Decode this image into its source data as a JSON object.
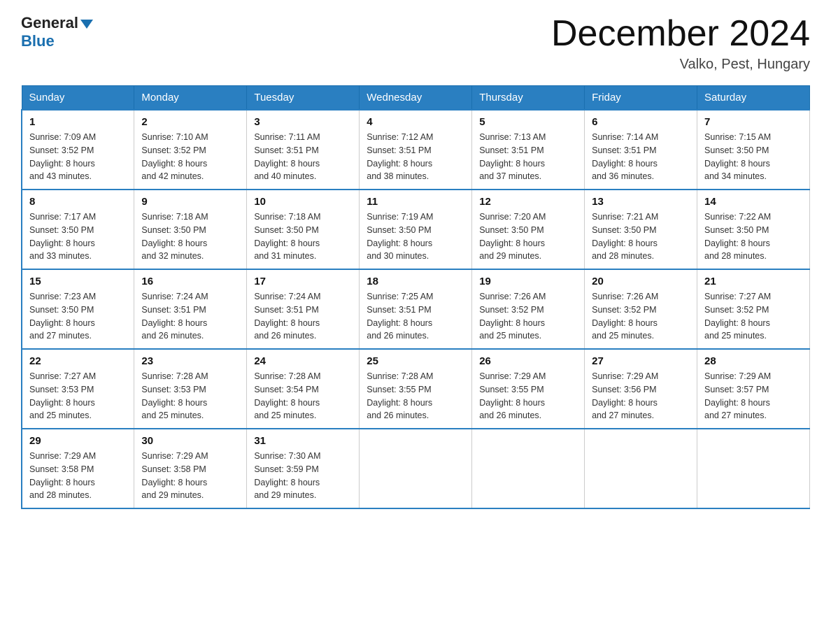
{
  "header": {
    "logo_general": "General",
    "logo_blue": "Blue",
    "month_title": "December 2024",
    "location": "Valko, Pest, Hungary"
  },
  "weekdays": [
    "Sunday",
    "Monday",
    "Tuesday",
    "Wednesday",
    "Thursday",
    "Friday",
    "Saturday"
  ],
  "weeks": [
    [
      {
        "day": "1",
        "sunrise": "7:09 AM",
        "sunset": "3:52 PM",
        "daylight": "8 hours and 43 minutes."
      },
      {
        "day": "2",
        "sunrise": "7:10 AM",
        "sunset": "3:52 PM",
        "daylight": "8 hours and 42 minutes."
      },
      {
        "day": "3",
        "sunrise": "7:11 AM",
        "sunset": "3:51 PM",
        "daylight": "8 hours and 40 minutes."
      },
      {
        "day": "4",
        "sunrise": "7:12 AM",
        "sunset": "3:51 PM",
        "daylight": "8 hours and 38 minutes."
      },
      {
        "day": "5",
        "sunrise": "7:13 AM",
        "sunset": "3:51 PM",
        "daylight": "8 hours and 37 minutes."
      },
      {
        "day": "6",
        "sunrise": "7:14 AM",
        "sunset": "3:51 PM",
        "daylight": "8 hours and 36 minutes."
      },
      {
        "day": "7",
        "sunrise": "7:15 AM",
        "sunset": "3:50 PM",
        "daylight": "8 hours and 34 minutes."
      }
    ],
    [
      {
        "day": "8",
        "sunrise": "7:17 AM",
        "sunset": "3:50 PM",
        "daylight": "8 hours and 33 minutes."
      },
      {
        "day": "9",
        "sunrise": "7:18 AM",
        "sunset": "3:50 PM",
        "daylight": "8 hours and 32 minutes."
      },
      {
        "day": "10",
        "sunrise": "7:18 AM",
        "sunset": "3:50 PM",
        "daylight": "8 hours and 31 minutes."
      },
      {
        "day": "11",
        "sunrise": "7:19 AM",
        "sunset": "3:50 PM",
        "daylight": "8 hours and 30 minutes."
      },
      {
        "day": "12",
        "sunrise": "7:20 AM",
        "sunset": "3:50 PM",
        "daylight": "8 hours and 29 minutes."
      },
      {
        "day": "13",
        "sunrise": "7:21 AM",
        "sunset": "3:50 PM",
        "daylight": "8 hours and 28 minutes."
      },
      {
        "day": "14",
        "sunrise": "7:22 AM",
        "sunset": "3:50 PM",
        "daylight": "8 hours and 28 minutes."
      }
    ],
    [
      {
        "day": "15",
        "sunrise": "7:23 AM",
        "sunset": "3:50 PM",
        "daylight": "8 hours and 27 minutes."
      },
      {
        "day": "16",
        "sunrise": "7:24 AM",
        "sunset": "3:51 PM",
        "daylight": "8 hours and 26 minutes."
      },
      {
        "day": "17",
        "sunrise": "7:24 AM",
        "sunset": "3:51 PM",
        "daylight": "8 hours and 26 minutes."
      },
      {
        "day": "18",
        "sunrise": "7:25 AM",
        "sunset": "3:51 PM",
        "daylight": "8 hours and 26 minutes."
      },
      {
        "day": "19",
        "sunrise": "7:26 AM",
        "sunset": "3:52 PM",
        "daylight": "8 hours and 25 minutes."
      },
      {
        "day": "20",
        "sunrise": "7:26 AM",
        "sunset": "3:52 PM",
        "daylight": "8 hours and 25 minutes."
      },
      {
        "day": "21",
        "sunrise": "7:27 AM",
        "sunset": "3:52 PM",
        "daylight": "8 hours and 25 minutes."
      }
    ],
    [
      {
        "day": "22",
        "sunrise": "7:27 AM",
        "sunset": "3:53 PM",
        "daylight": "8 hours and 25 minutes."
      },
      {
        "day": "23",
        "sunrise": "7:28 AM",
        "sunset": "3:53 PM",
        "daylight": "8 hours and 25 minutes."
      },
      {
        "day": "24",
        "sunrise": "7:28 AM",
        "sunset": "3:54 PM",
        "daylight": "8 hours and 25 minutes."
      },
      {
        "day": "25",
        "sunrise": "7:28 AM",
        "sunset": "3:55 PM",
        "daylight": "8 hours and 26 minutes."
      },
      {
        "day": "26",
        "sunrise": "7:29 AM",
        "sunset": "3:55 PM",
        "daylight": "8 hours and 26 minutes."
      },
      {
        "day": "27",
        "sunrise": "7:29 AM",
        "sunset": "3:56 PM",
        "daylight": "8 hours and 27 minutes."
      },
      {
        "day": "28",
        "sunrise": "7:29 AM",
        "sunset": "3:57 PM",
        "daylight": "8 hours and 27 minutes."
      }
    ],
    [
      {
        "day": "29",
        "sunrise": "7:29 AM",
        "sunset": "3:58 PM",
        "daylight": "8 hours and 28 minutes."
      },
      {
        "day": "30",
        "sunrise": "7:29 AM",
        "sunset": "3:58 PM",
        "daylight": "8 hours and 29 minutes."
      },
      {
        "day": "31",
        "sunrise": "7:30 AM",
        "sunset": "3:59 PM",
        "daylight": "8 hours and 29 minutes."
      },
      null,
      null,
      null,
      null
    ]
  ],
  "labels": {
    "sunrise": "Sunrise:",
    "sunset": "Sunset:",
    "daylight": "Daylight:"
  }
}
